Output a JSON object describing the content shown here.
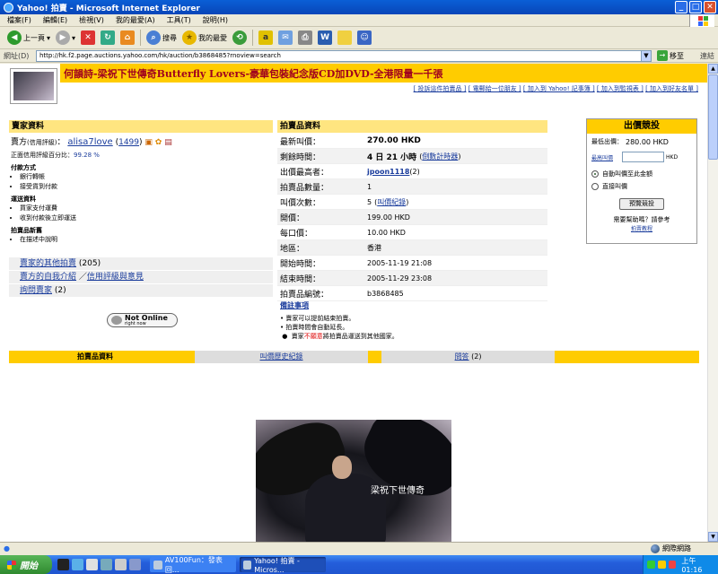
{
  "window": {
    "title": "Yahoo! 拍賣 - Microsoft Internet Explorer",
    "minimize": "_",
    "maximize": "□",
    "close": "✕"
  },
  "menu": [
    "檔案(F)",
    "編輯(E)",
    "檢視(V)",
    "我的最愛(A)",
    "工具(T)",
    "說明(H)"
  ],
  "toolbar": {
    "back": "上一頁",
    "search": "搜尋",
    "favorites": "我的最愛"
  },
  "address": {
    "label": "網址(D)",
    "url": "http://hk.f2.page.auctions.yahoo.com/hk/auction/b3868485?rnoview=search",
    "go": "移至",
    "links": "連結"
  },
  "page": {
    "title": "何韻詩-梁祝下世傳奇Butterfly Lovers-豪華包裝紀念版CD加DVD-全港限量一千張",
    "toplinks": [
      "[ 投訴這件拍賣品 ]",
      "[ 電郵給一位朋友 ]",
      "[ 加入到 Yahoo! 記事簿 ]",
      "[ 加入到監視表 ]",
      "[ 加入到好友名單 ]"
    ]
  },
  "seller": {
    "heading": "賣家資料",
    "seller_label": "賣方",
    "rating_note": "(信用評級)",
    "seller_name": "alisa7love",
    "open_paren": "(",
    "rating": "1499",
    "close_paren": ")",
    "positive_label": "正面信用評級百分比：",
    "positive_value": "99.28 %",
    "payment_heading": "付款方式",
    "payment": [
      "銀行轉帳",
      "接受貨到付款"
    ],
    "shipping_heading": "運送資料",
    "shipping": [
      "買家支付運費",
      "收到付款後立即運送"
    ],
    "condition_heading": "拍賣品新舊",
    "condition": [
      "在描述中說明"
    ],
    "links": [
      {
        "text": "賣家的其他拍賣",
        "extra": " (205)"
      },
      {
        "text": "賣方的自我介紹",
        "sep": " ／",
        "text2": "信用評級與意見"
      },
      {
        "text": "詢問賣家",
        "extra": " (2)"
      }
    ],
    "status_main": "Not Online",
    "status_sub": "right now"
  },
  "item": {
    "heading": "拍賣品資料",
    "rows": [
      {
        "k": "最新叫價：",
        "v": "270.00 HKD"
      },
      {
        "k": "剩餘時間：",
        "v": "4 日 21 小時",
        "link": "倒數計時器"
      },
      {
        "k": "出價最高者：",
        "v": "jpoon1118",
        "extra": " (2)"
      },
      {
        "k": "拍賣品數量：",
        "v": "1"
      },
      {
        "k": "叫價次數：",
        "v": "5",
        "link": "叫價紀錄"
      },
      {
        "k": "開價：",
        "v": "199.00 HKD"
      },
      {
        "k": "每口價：",
        "v": "10.00 HKD"
      },
      {
        "k": "地區：",
        "v": "香港"
      },
      {
        "k": "開始時間：",
        "v": "2005-11-19 21:08"
      },
      {
        "k": "結束時間：",
        "v": "2005-11-29 23:08"
      },
      {
        "k": "拍賣品編號：",
        "v": "b3868485"
      }
    ],
    "notes_heading": "備註事項",
    "note1": "• 賣家可以提前結束拍賣。",
    "note2": "• 拍賣時間會自動延長。",
    "note3_pre": "賣家",
    "note3_red": "不願意",
    "note3_post": "將拍賣品運送到其他國家。"
  },
  "bid": {
    "heading": "出價競投",
    "min_label": "最低出價：",
    "min_value": "280.00 HKD",
    "max_link": "最高叫價",
    "currency": "HKD",
    "opt1": "自動叫價至此金額",
    "opt2": "直接叫價",
    "preview": "預覽競投",
    "help": "需要幫助嗎？請參考",
    "help_link": "拍賣教程"
  },
  "tabs": {
    "t1": "拍賣品資料",
    "t2": "叫價歷史紀錄",
    "t3": "問答",
    "t3_count": " (2)"
  },
  "photo": {
    "caption": "梁祝下世傳奇"
  },
  "status": {
    "zone": "網際網路"
  },
  "taskbar": {
    "start": "開始",
    "task1": "AV100Fun：發表回...",
    "task2": "Yahoo! 拍賣 - Micros...",
    "clock": "上午 01:16"
  }
}
